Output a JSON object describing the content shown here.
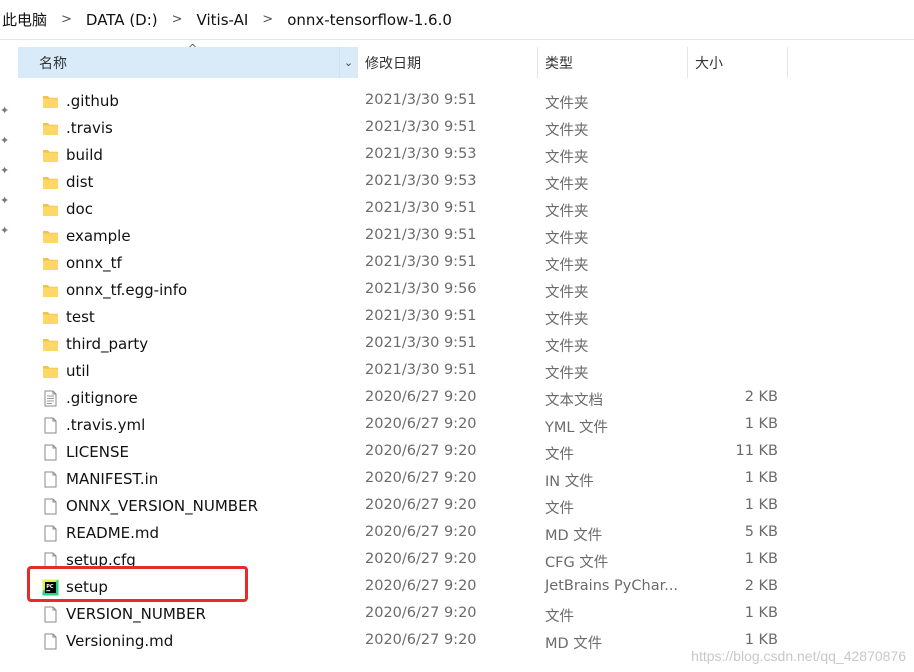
{
  "breadcrumb": [
    "此电脑",
    "DATA (D:)",
    "Vitis-AI",
    "onnx-tensorflow-1.6.0"
  ],
  "columns": {
    "name": "名称",
    "date": "修改日期",
    "type": "类型",
    "size": "大小"
  },
  "files": [
    {
      "name": ".github",
      "date": "2021/3/30 9:51",
      "type": "文件夹",
      "size": "",
      "icon": "folder-icon"
    },
    {
      "name": ".travis",
      "date": "2021/3/30 9:51",
      "type": "文件夹",
      "size": "",
      "icon": "folder-icon"
    },
    {
      "name": "build",
      "date": "2021/3/30 9:53",
      "type": "文件夹",
      "size": "",
      "icon": "folder-icon"
    },
    {
      "name": "dist",
      "date": "2021/3/30 9:53",
      "type": "文件夹",
      "size": "",
      "icon": "folder-icon"
    },
    {
      "name": "doc",
      "date": "2021/3/30 9:51",
      "type": "文件夹",
      "size": "",
      "icon": "folder-icon"
    },
    {
      "name": "example",
      "date": "2021/3/30 9:51",
      "type": "文件夹",
      "size": "",
      "icon": "folder-icon"
    },
    {
      "name": "onnx_tf",
      "date": "2021/3/30 9:51",
      "type": "文件夹",
      "size": "",
      "icon": "folder-icon"
    },
    {
      "name": "onnx_tf.egg-info",
      "date": "2021/3/30 9:56",
      "type": "文件夹",
      "size": "",
      "icon": "folder-icon"
    },
    {
      "name": "test",
      "date": "2021/3/30 9:51",
      "type": "文件夹",
      "size": "",
      "icon": "folder-icon"
    },
    {
      "name": "third_party",
      "date": "2021/3/30 9:51",
      "type": "文件夹",
      "size": "",
      "icon": "folder-icon"
    },
    {
      "name": "util",
      "date": "2021/3/30 9:51",
      "type": "文件夹",
      "size": "",
      "icon": "folder-icon"
    },
    {
      "name": ".gitignore",
      "date": "2020/6/27 9:20",
      "type": "文本文档",
      "size": "2 KB",
      "icon": "text-file-icon"
    },
    {
      "name": ".travis.yml",
      "date": "2020/6/27 9:20",
      "type": "YML 文件",
      "size": "1 KB",
      "icon": "file-icon"
    },
    {
      "name": "LICENSE",
      "date": "2020/6/27 9:20",
      "type": "文件",
      "size": "11 KB",
      "icon": "file-icon"
    },
    {
      "name": "MANIFEST.in",
      "date": "2020/6/27 9:20",
      "type": "IN 文件",
      "size": "1 KB",
      "icon": "file-icon"
    },
    {
      "name": "ONNX_VERSION_NUMBER",
      "date": "2020/6/27 9:20",
      "type": "文件",
      "size": "1 KB",
      "icon": "file-icon"
    },
    {
      "name": "README.md",
      "date": "2020/6/27 9:20",
      "type": "MD 文件",
      "size": "5 KB",
      "icon": "file-icon"
    },
    {
      "name": "setup.cfg",
      "date": "2020/6/27 9:20",
      "type": "CFG 文件",
      "size": "1 KB",
      "icon": "file-icon"
    },
    {
      "name": "setup",
      "date": "2020/6/27 9:20",
      "type": "JetBrains PyChar...",
      "size": "2 KB",
      "icon": "pycharm-icon"
    },
    {
      "name": "VERSION_NUMBER",
      "date": "2020/6/27 9:20",
      "type": "文件",
      "size": "1 KB",
      "icon": "file-icon"
    },
    {
      "name": "Versioning.md",
      "date": "2020/6/27 9:20",
      "type": "MD 文件",
      "size": "1 KB",
      "icon": "file-icon"
    }
  ],
  "watermark": "https://blog.csdn.net/qq_42870876",
  "colors": {
    "highlight": "#e62b2b",
    "folder": "#f2c14e",
    "header_selected": "#d9ebf9"
  }
}
